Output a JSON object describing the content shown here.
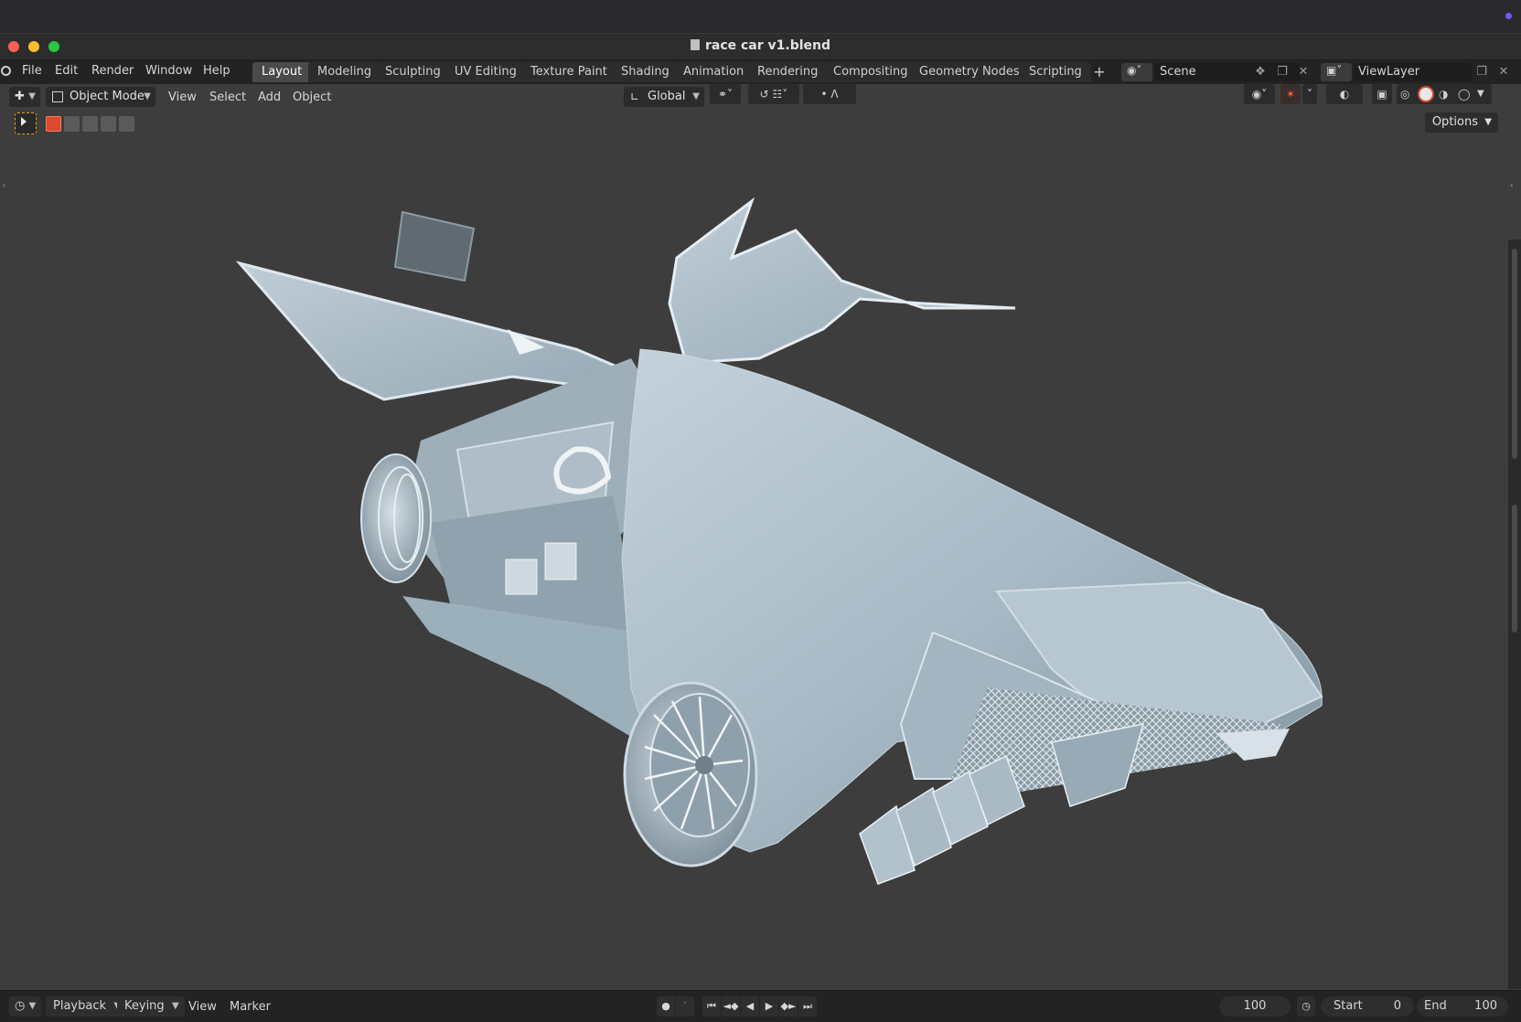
{
  "window": {
    "title": "race car v1.blend"
  },
  "menubar": {
    "items": [
      "File",
      "Edit",
      "Render",
      "Window",
      "Help"
    ]
  },
  "workspace_tabs": [
    "Layout",
    "Modeling",
    "Sculpting",
    "UV Editing",
    "Texture Paint",
    "Shading",
    "Animation",
    "Rendering",
    "Compositing",
    "Geometry Nodes",
    "Scripting"
  ],
  "active_tab": "Layout",
  "scene": {
    "label": "Scene"
  },
  "view_layer": {
    "label": "ViewLayer"
  },
  "viewport_header": {
    "mode": "Object Mode",
    "menus": [
      "View",
      "Select",
      "Add",
      "Object"
    ],
    "transform_orientation": "Global",
    "options_label": "Options"
  },
  "colors": {
    "accent_active": "#d94a2f",
    "viewport_bg": "#3d3d3d",
    "car_body": "#a9bcc8"
  },
  "timeline": {
    "playback_label": "Playback",
    "keying_label": "Keying",
    "view_label": "View",
    "marker_label": "Marker",
    "current_frame": "100",
    "start_label": "Start",
    "start_value": "0",
    "end_label": "End",
    "end_value": "100"
  }
}
